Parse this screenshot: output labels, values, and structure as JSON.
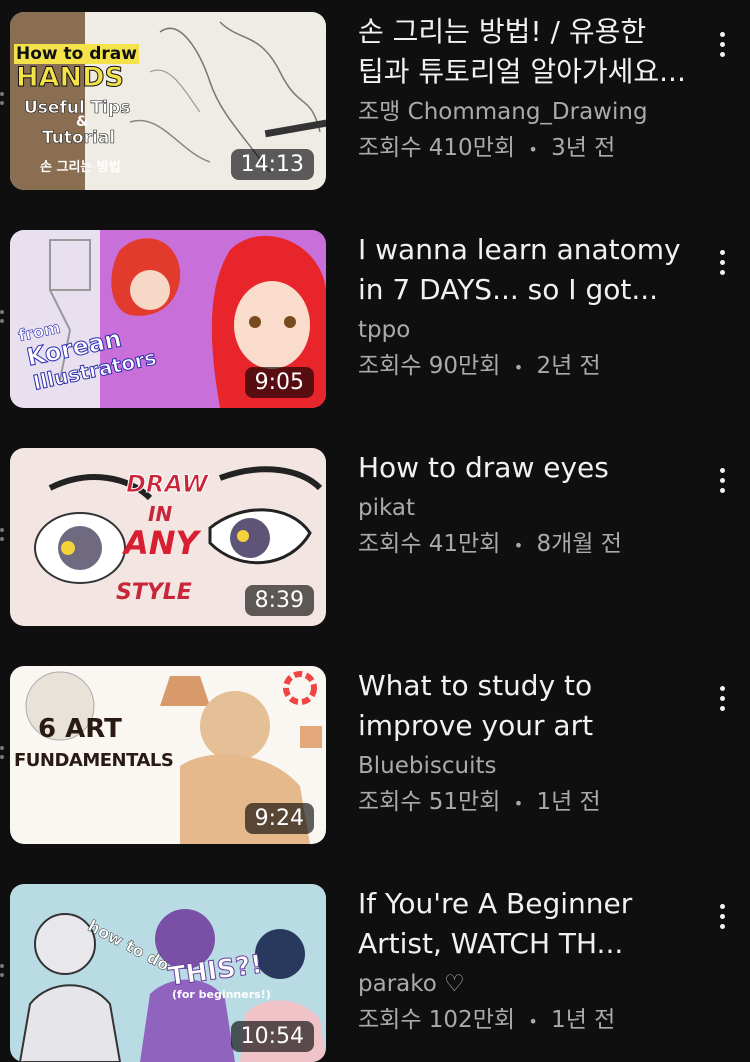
{
  "videos": [
    {
      "title": "손 그리는 방법! / 유용한 팁과 튜토리얼 알아가세요...",
      "channel": "조맹 Chommang_Drawing",
      "views": "조회수 410만회",
      "age": "3년 전",
      "duration": "14:13",
      "thumb_text": {
        "line1": "How to draw",
        "line2": "HANDS",
        "line3": "Useful Tips",
        "line4": "&",
        "line5": "Tutorial",
        "line6": "손 그리는 방법"
      }
    },
    {
      "title": "I wanna learn anatomy in 7 DAYS... so I got...",
      "channel": "tppo",
      "views": "조회수 90만회",
      "age": "2년 전",
      "duration": "9:05",
      "thumb_text": {
        "line1": "from",
        "line2": "Korean",
        "line3": "Illustrators"
      }
    },
    {
      "title": "How to draw eyes",
      "channel": "pikat",
      "views": "조회수 41만회",
      "age": "8개월 전",
      "duration": "8:39",
      "thumb_text": {
        "line1": "DRAW",
        "line2": "IN",
        "line3": "ANY",
        "line4": "STYLE"
      }
    },
    {
      "title": "What to study to improve your art",
      "channel": "Bluebiscuits",
      "views": "조회수 51만회",
      "age": "1년 전",
      "duration": "9:24",
      "thumb_text": {
        "line1": "6 ART",
        "line2": "FUNDAMENTALS"
      }
    },
    {
      "title": "If You're A Beginner Artist, WATCH TH...",
      "channel": "parako ♡",
      "views": "조회수 102만회",
      "age": "1년 전",
      "duration": "10:54",
      "thumb_text": {
        "line1": "how to do",
        "line2": "THIS?!",
        "line3": "(for beginners!)"
      }
    }
  ],
  "separator": "•",
  "colors": {
    "background": "#0f0f0f",
    "primary_text": "#f1f1f1",
    "secondary_text": "#aaaaaa"
  }
}
